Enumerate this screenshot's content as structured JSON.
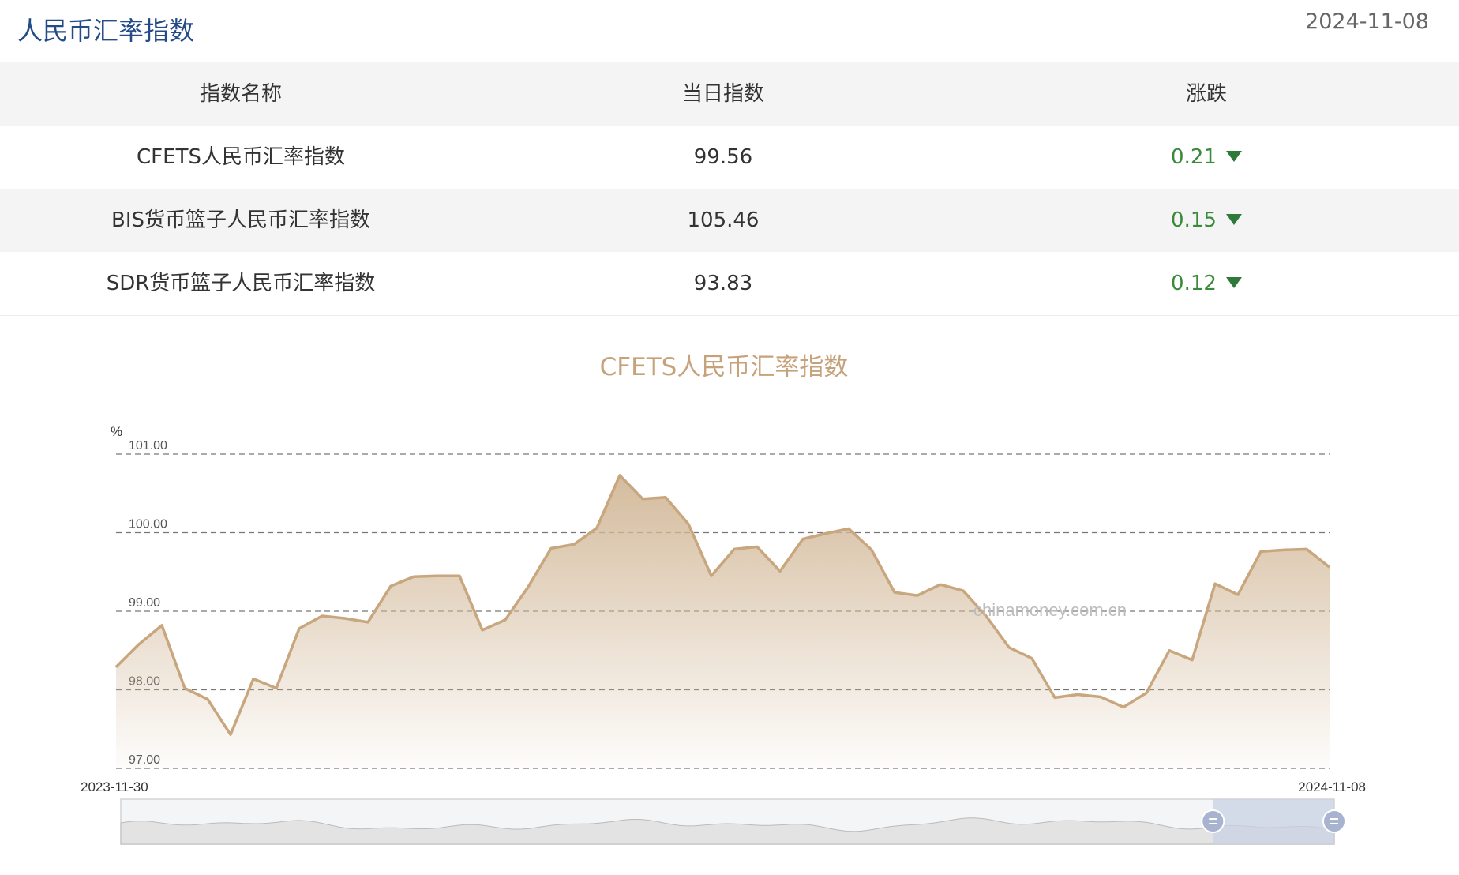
{
  "header": {
    "title": "人民币汇率指数",
    "date": "2024-11-08"
  },
  "table": {
    "columns": [
      "指数名称",
      "当日指数",
      "涨跌"
    ],
    "rows": [
      {
        "name": "CFETS人民币汇率指数",
        "value": "99.56",
        "change": "0.21",
        "direction": "down"
      },
      {
        "name": "BIS货币篮子人民币汇率指数",
        "value": "105.46",
        "change": "0.15",
        "direction": "down"
      },
      {
        "name": "SDR货币篮子人民币汇率指数",
        "value": "93.83",
        "change": "0.12",
        "direction": "down"
      }
    ]
  },
  "colors": {
    "title_blue": "#234b87",
    "line": "#c8a67e",
    "change_green": "#3a8a3a",
    "chart_title": "#c6a27a"
  },
  "chart_data": {
    "type": "area",
    "title": "CFETS人民币汇率指数",
    "ylabel": "%",
    "ylim": [
      97.0,
      101.0
    ],
    "y_ticks": [
      "101.00",
      "100.00",
      "99.00",
      "98.00",
      "97.00"
    ],
    "x_range_labels": [
      "2023-11-30",
      "2024-11-08"
    ],
    "grid": true,
    "watermark": "chinamoney.com.cn",
    "series": [
      {
        "values": [
          98.29,
          98.58,
          98.82,
          98.02,
          97.88,
          97.43,
          98.14,
          98.02,
          98.78,
          98.94,
          98.91,
          98.86,
          99.32,
          99.44,
          99.45,
          99.45,
          98.76,
          98.89,
          99.31,
          99.8,
          99.85,
          100.06,
          100.73,
          100.43,
          100.45,
          100.11,
          99.45,
          99.79,
          99.82,
          99.51,
          99.92,
          99.99,
          100.05,
          99.78,
          99.24,
          99.2,
          99.34,
          99.26,
          98.94,
          98.54,
          98.4,
          97.9,
          97.94,
          97.91,
          97.78,
          97.96,
          98.5,
          98.38,
          99.35,
          99.21,
          99.76,
          99.78,
          99.79,
          99.56
        ]
      }
    ],
    "navigator": {
      "window_start_fraction": 0.9,
      "window_end_fraction": 1.0
    }
  }
}
